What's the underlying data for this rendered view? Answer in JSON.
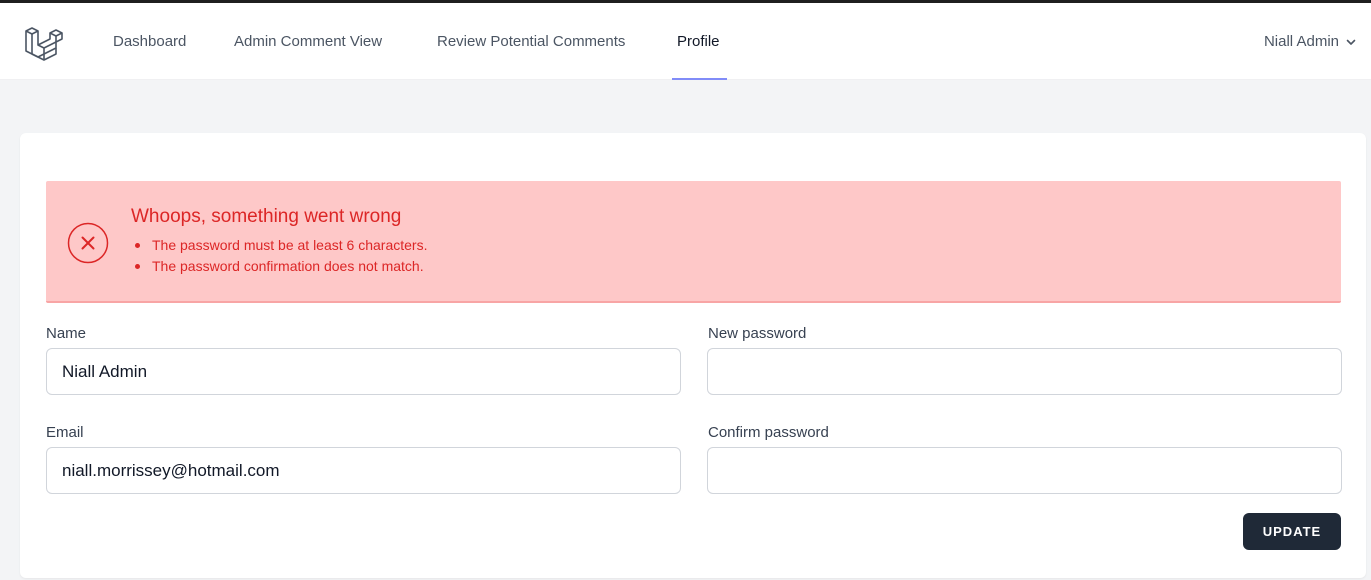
{
  "nav": {
    "links": [
      "Dashboard",
      "Admin Comment View",
      "Review Potential Comments",
      "Profile"
    ],
    "active": "Profile",
    "user_name": "Niall Admin"
  },
  "alert": {
    "title": "Whoops, something went wrong",
    "errors": [
      "The password must be at least 6 characters.",
      "The password confirmation does not match."
    ]
  },
  "form": {
    "name_label": "Name",
    "name_value": "Niall Admin",
    "email_label": "Email",
    "email_value": "niall.morrissey@hotmail.com",
    "new_password_label": "New password",
    "new_password_value": "",
    "confirm_password_label": "Confirm password",
    "confirm_password_value": "",
    "submit_label": "UPDATE"
  },
  "icons": {
    "logo": "laravel-logo-icon",
    "user_menu": "chevron-down-icon",
    "alert": "error-x-circle-icon"
  },
  "colors": {
    "alert_bg": "#fec8c8",
    "alert_text": "#dc2626",
    "button_bg": "#1f2937",
    "active_underline": "#818cf8"
  }
}
